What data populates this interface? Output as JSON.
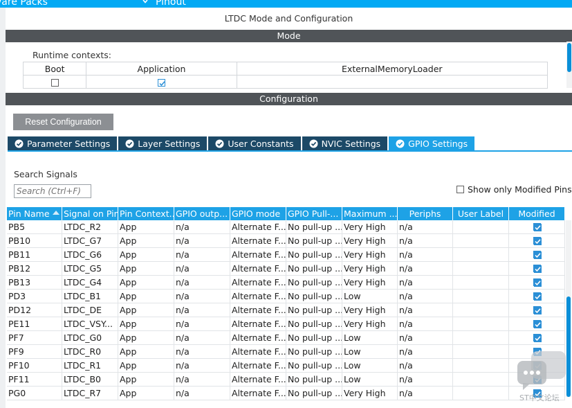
{
  "header": {
    "tab_left": "vare Packs",
    "tab_right": "Pinout"
  },
  "panel": {
    "title": "LTDC Mode and Configuration",
    "mode_section": "Mode",
    "config_section": "Configuration"
  },
  "runtime_contexts": {
    "label": "Runtime contexts:",
    "columns": [
      {
        "name": "Boot",
        "checked": false
      },
      {
        "name": "Application",
        "checked": true
      },
      {
        "name": "ExternalMemoryLoader",
        "checked": null
      }
    ]
  },
  "config": {
    "reset_label": "Reset Configuration",
    "tabs": [
      {
        "label": "Parameter Settings",
        "active": false
      },
      {
        "label": "Layer Settings",
        "active": false
      },
      {
        "label": "User Constants",
        "active": false
      },
      {
        "label": "NVIC Settings",
        "active": false
      },
      {
        "label": "GPIO Settings",
        "active": true
      }
    ]
  },
  "search": {
    "label": "Search Signals",
    "placeholder": "Search (Ctrl+F)"
  },
  "filter": {
    "show_modified_label": "Show only Modified Pins",
    "checked": false
  },
  "table": {
    "headers": [
      "Pin Name",
      "Signal on Pin",
      "Pin Context...",
      "GPIO outp...",
      "GPIO mode",
      "GPIO Pull-...",
      "Maximum ...",
      "Periphs",
      "User Label",
      "Modified"
    ],
    "sort_column": 0,
    "rows": [
      [
        "PB5",
        "LTDC_R2",
        "App",
        "n/a",
        "Alternate F...",
        "No pull-up ...",
        "Very High",
        "n/a",
        "",
        true
      ],
      [
        "PB10",
        "LTDC_G7",
        "App",
        "n/a",
        "Alternate F...",
        "No pull-up ...",
        "Very High",
        "n/a",
        "",
        true
      ],
      [
        "PB11",
        "LTDC_G6",
        "App",
        "n/a",
        "Alternate F...",
        "No pull-up ...",
        "Very High",
        "n/a",
        "",
        true
      ],
      [
        "PB12",
        "LTDC_G5",
        "App",
        "n/a",
        "Alternate F...",
        "No pull-up ...",
        "Very High",
        "n/a",
        "",
        true
      ],
      [
        "PB13",
        "LTDC_G4",
        "App",
        "n/a",
        "Alternate F...",
        "No pull-up ...",
        "Very High",
        "n/a",
        "",
        true
      ],
      [
        "PD3",
        "LTDC_B1",
        "App",
        "n/a",
        "Alternate F...",
        "No pull-up ...",
        "Low",
        "n/a",
        "",
        true
      ],
      [
        "PD12",
        "LTDC_DE",
        "App",
        "n/a",
        "Alternate F...",
        "No pull-up ...",
        "Very High",
        "n/a",
        "",
        true
      ],
      [
        "PE11",
        "LTDC_VSY...",
        "App",
        "n/a",
        "Alternate F...",
        "No pull-up ...",
        "Very High",
        "n/a",
        "",
        true
      ],
      [
        "PF7",
        "LTDC_G0",
        "App",
        "n/a",
        "Alternate F...",
        "No pull-up ...",
        "Low",
        "n/a",
        "",
        true
      ],
      [
        "PF9",
        "LTDC_R0",
        "App",
        "n/a",
        "Alternate F...",
        "No pull-up ...",
        "Low",
        "n/a",
        "",
        true
      ],
      [
        "PF10",
        "LTDC_R1",
        "App",
        "n/a",
        "Alternate F...",
        "No pull-up ...",
        "Low",
        "n/a",
        "",
        true
      ],
      [
        "PF11",
        "LTDC_B0",
        "App",
        "n/a",
        "Alternate F...",
        "No pull-up ...",
        "Low",
        "n/a",
        "",
        true
      ],
      [
        "PG0",
        "LTDC_R7",
        "App",
        "n/a",
        "Alternate F...",
        "No pull-up ...",
        "Very High",
        "n/a",
        "",
        true
      ]
    ]
  },
  "watermark": {
    "text": "ST中文论坛",
    "icon": "chat-bubbles-icon"
  },
  "colors": {
    "accent": "#1ea2e6",
    "header_bar": "#03a9f4",
    "tab_inactive": "#1c4967",
    "section_bar": "#505458",
    "reset_button": "#8c8f93"
  }
}
